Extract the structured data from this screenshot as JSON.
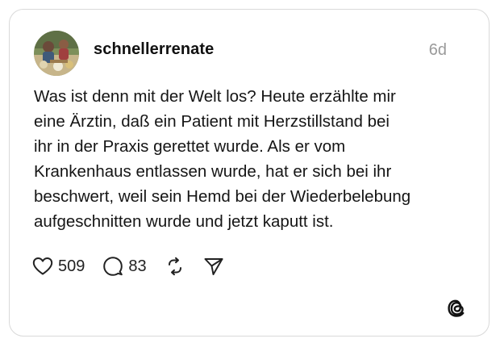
{
  "post": {
    "username": "schnellerrenate",
    "timestamp": "6d",
    "text_lines": [
      "Was ist denn mit der Welt los? Heute erzählte mir",
      "eine Ärztin, daß ein Patient mit Herzstillstand bei",
      "ihr in der Praxis gerettet wurde. Als er vom",
      "Krankenhaus entlassen wurde, hat er sich bei ihr",
      "beschwert, weil sein Hemd bei der Wiederbelebung",
      "aufgeschnitten wurde und jetzt kaputt ist."
    ]
  },
  "actions": {
    "likes": "509",
    "replies": "83",
    "like_icon": "heart-icon",
    "reply_icon": "speech-bubble-icon",
    "repost_icon": "repost-icon",
    "share_icon": "send-icon"
  },
  "branding": {
    "logo_icon": "threads-logo-icon"
  },
  "colors": {
    "border": "#d9d9d9",
    "text": "#111111",
    "muted": "#9a9a9a"
  }
}
